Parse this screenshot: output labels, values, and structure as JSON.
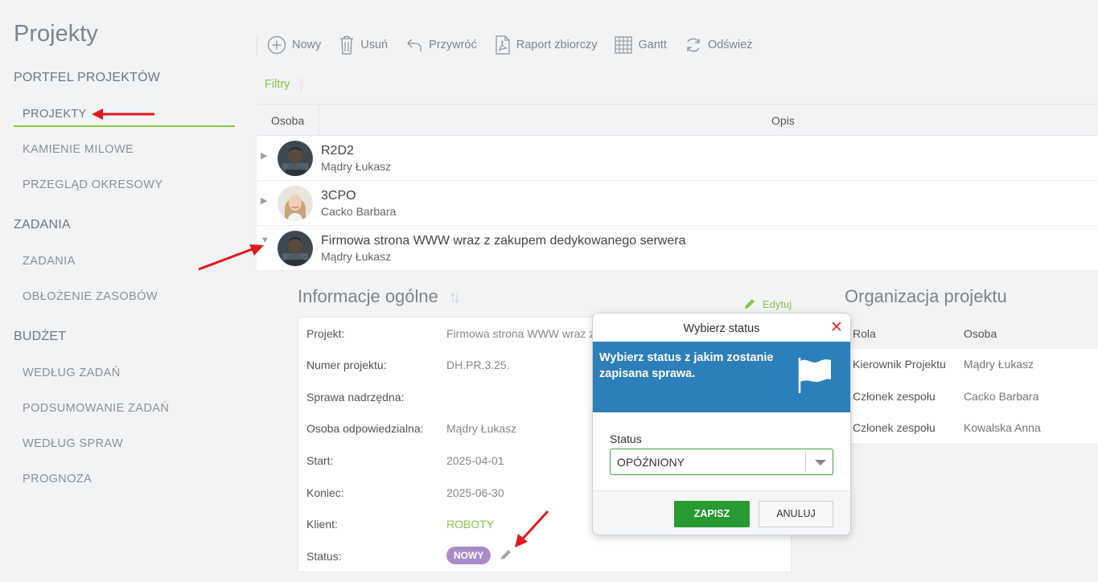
{
  "sidebar": {
    "title": "Projekty",
    "groups": [
      {
        "label": "PORTFEL PROJEKTÓW"
      },
      {
        "label": "ZADANIA"
      },
      {
        "label": "BUDŻET"
      }
    ],
    "items": [
      {
        "label": "PROJEKTY"
      },
      {
        "label": "KAMIENIE MILOWE"
      },
      {
        "label": "PRZEGLĄD OKRESOWY"
      },
      {
        "label": "ZADANIA"
      },
      {
        "label": "OBŁOŻENIE ZASOBÓW"
      },
      {
        "label": "WEDŁUG ZADAŃ"
      },
      {
        "label": "PODSUMOWANIE ZADAŃ"
      },
      {
        "label": "WEDŁUG SPRAW"
      },
      {
        "label": "PROGNOZA"
      }
    ]
  },
  "toolbar": {
    "new_label": "Nowy",
    "delete_label": "Usuń",
    "restore_label": "Przywróć",
    "report_label": "Raport zbiorczy",
    "gantt_label": "Gantt",
    "refresh_label": "Odśwież"
  },
  "filters_label": "Filtry",
  "grid": {
    "columns": [
      "Osoba",
      "Opis"
    ],
    "rows": [
      {
        "title": "R2D2",
        "person": "Mądry Łukasz"
      },
      {
        "title": "3CPO",
        "person": "Cacko Barbara"
      },
      {
        "title": "Firmowa strona WWW wraz z zakupem dedykowanego serwera",
        "person": "Mądry Łukasz"
      }
    ]
  },
  "info": {
    "title": "Informacje ogólne",
    "edit_label": "Edytuj",
    "fields": [
      {
        "label": "Projekt:",
        "value": "Firmowa strona WWW wraz z"
      },
      {
        "label": "Numer projektu:",
        "value": "DH.PR.3.25."
      },
      {
        "label": "Sprawa nadrzędna:",
        "value": ""
      },
      {
        "label": "Osoba odpowiedzialna:",
        "value": "Mądry Łukasz"
      },
      {
        "label": "Start:",
        "value": "2025-04-01"
      },
      {
        "label": "Koniec:",
        "value": "2025-06-30"
      },
      {
        "label": "Klient:",
        "value": "ROBOTY"
      },
      {
        "label": "Status:",
        "value": "NOWY"
      }
    ]
  },
  "org": {
    "title": "Organizacja projektu",
    "columns": [
      "Rola",
      "Osoba"
    ],
    "rows": [
      {
        "role": "Kierownik Projektu",
        "person": "Mądry Łukasz"
      },
      {
        "role": "Członek zespołu",
        "person": "Cacko Barbara"
      },
      {
        "role": "Członek zespołu",
        "person": "Kowalska Anna"
      }
    ]
  },
  "modal": {
    "title": "Wybierz status",
    "banner": "Wybierz status z jakim zostanie zapisana sprawa.",
    "field_label": "Status",
    "selected": "OPÓŹNIONY",
    "save_label": "ZAPISZ",
    "cancel_label": "ANULUJ"
  },
  "colors": {
    "accent": "#8bc34a",
    "banner": "#2c7fb8",
    "save": "#279b31",
    "badge": "#a88cc9",
    "close": "#d9342b",
    "annotation_arrow": "#e0191c"
  }
}
